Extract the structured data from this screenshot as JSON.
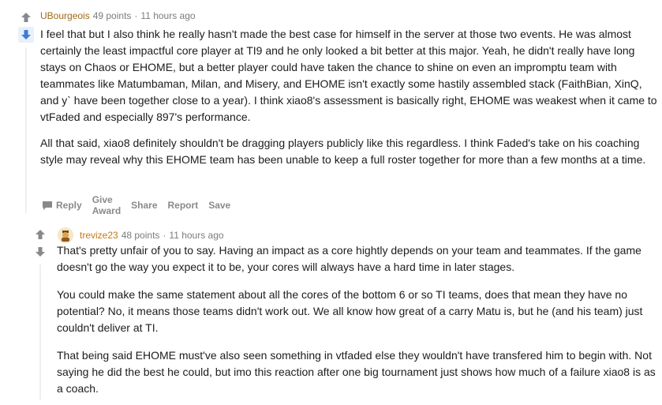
{
  "comment1": {
    "author": "UBourgeois",
    "points": "49 points",
    "sep": "·",
    "time": "11 hours ago",
    "paragraphs": [
      "I feel that but I also think he really hasn't made the best case for himself in the server at those two events. He was almost certainly the least impactful core player at TI9 and he only looked a bit better at this major. Yeah, he didn't really have long stays on Chaos or EHOME, but a better player could have taken the chance to shine on even an impromptu team with teammates like Matumbaman, Milan, and Misery, and EHOME isn't exactly some hastily assembled stack (FaithBian, XinQ, and y` have been together close to a year). I think xiao8's assessment is basically right, EHOME was weakest when it came to vtFaded and especially 897's performance.",
      "All that said, xiao8 definitely shouldn't be dragging players publicly like this regardless. I think Faded's take on his coaching style may reveal why this EHOME team has been unable to keep a full roster together for more than a few months at a time."
    ],
    "actions": {
      "reply": "Reply",
      "give_award": "Give Award",
      "share": "Share",
      "report": "Report",
      "save": "Save"
    }
  },
  "comment2": {
    "author": "trevize23",
    "points": "48 points",
    "sep": "·",
    "time": "11 hours ago",
    "paragraphs": [
      "That's pretty unfair of you to say. Having an impact as a core hightly depends on your team and teammates. If the game doesn't go the way you expect it to be, your cores will always have a hard time in later stages.",
      "You could make the same statement about all the cores of the bottom 6 or so TI teams, does that mean they have no potential? No, it means those teams didn't work out. We all know how great of a carry Matu is, but he (and his team) just couldn't deliver at TI.",
      "That being said EHOME must've also seen something in vtfaded else they wouldn't have transfered him to begin with. Not saying he did the best he could, but imo this reaction after one big tournament just shows how much of a failure xiao8 is as a coach."
    ]
  },
  "icons": {
    "upvote": "upvote-arrow-icon",
    "downvote": "downvote-arrow-icon",
    "reply": "speech-bubble-icon",
    "avatar": "user-avatar-icon"
  },
  "colors": {
    "downvote_active": "#3e7cd6",
    "vote_inactive": "#878a8c",
    "author": "#a06a18",
    "meta": "#7c7c7c"
  }
}
